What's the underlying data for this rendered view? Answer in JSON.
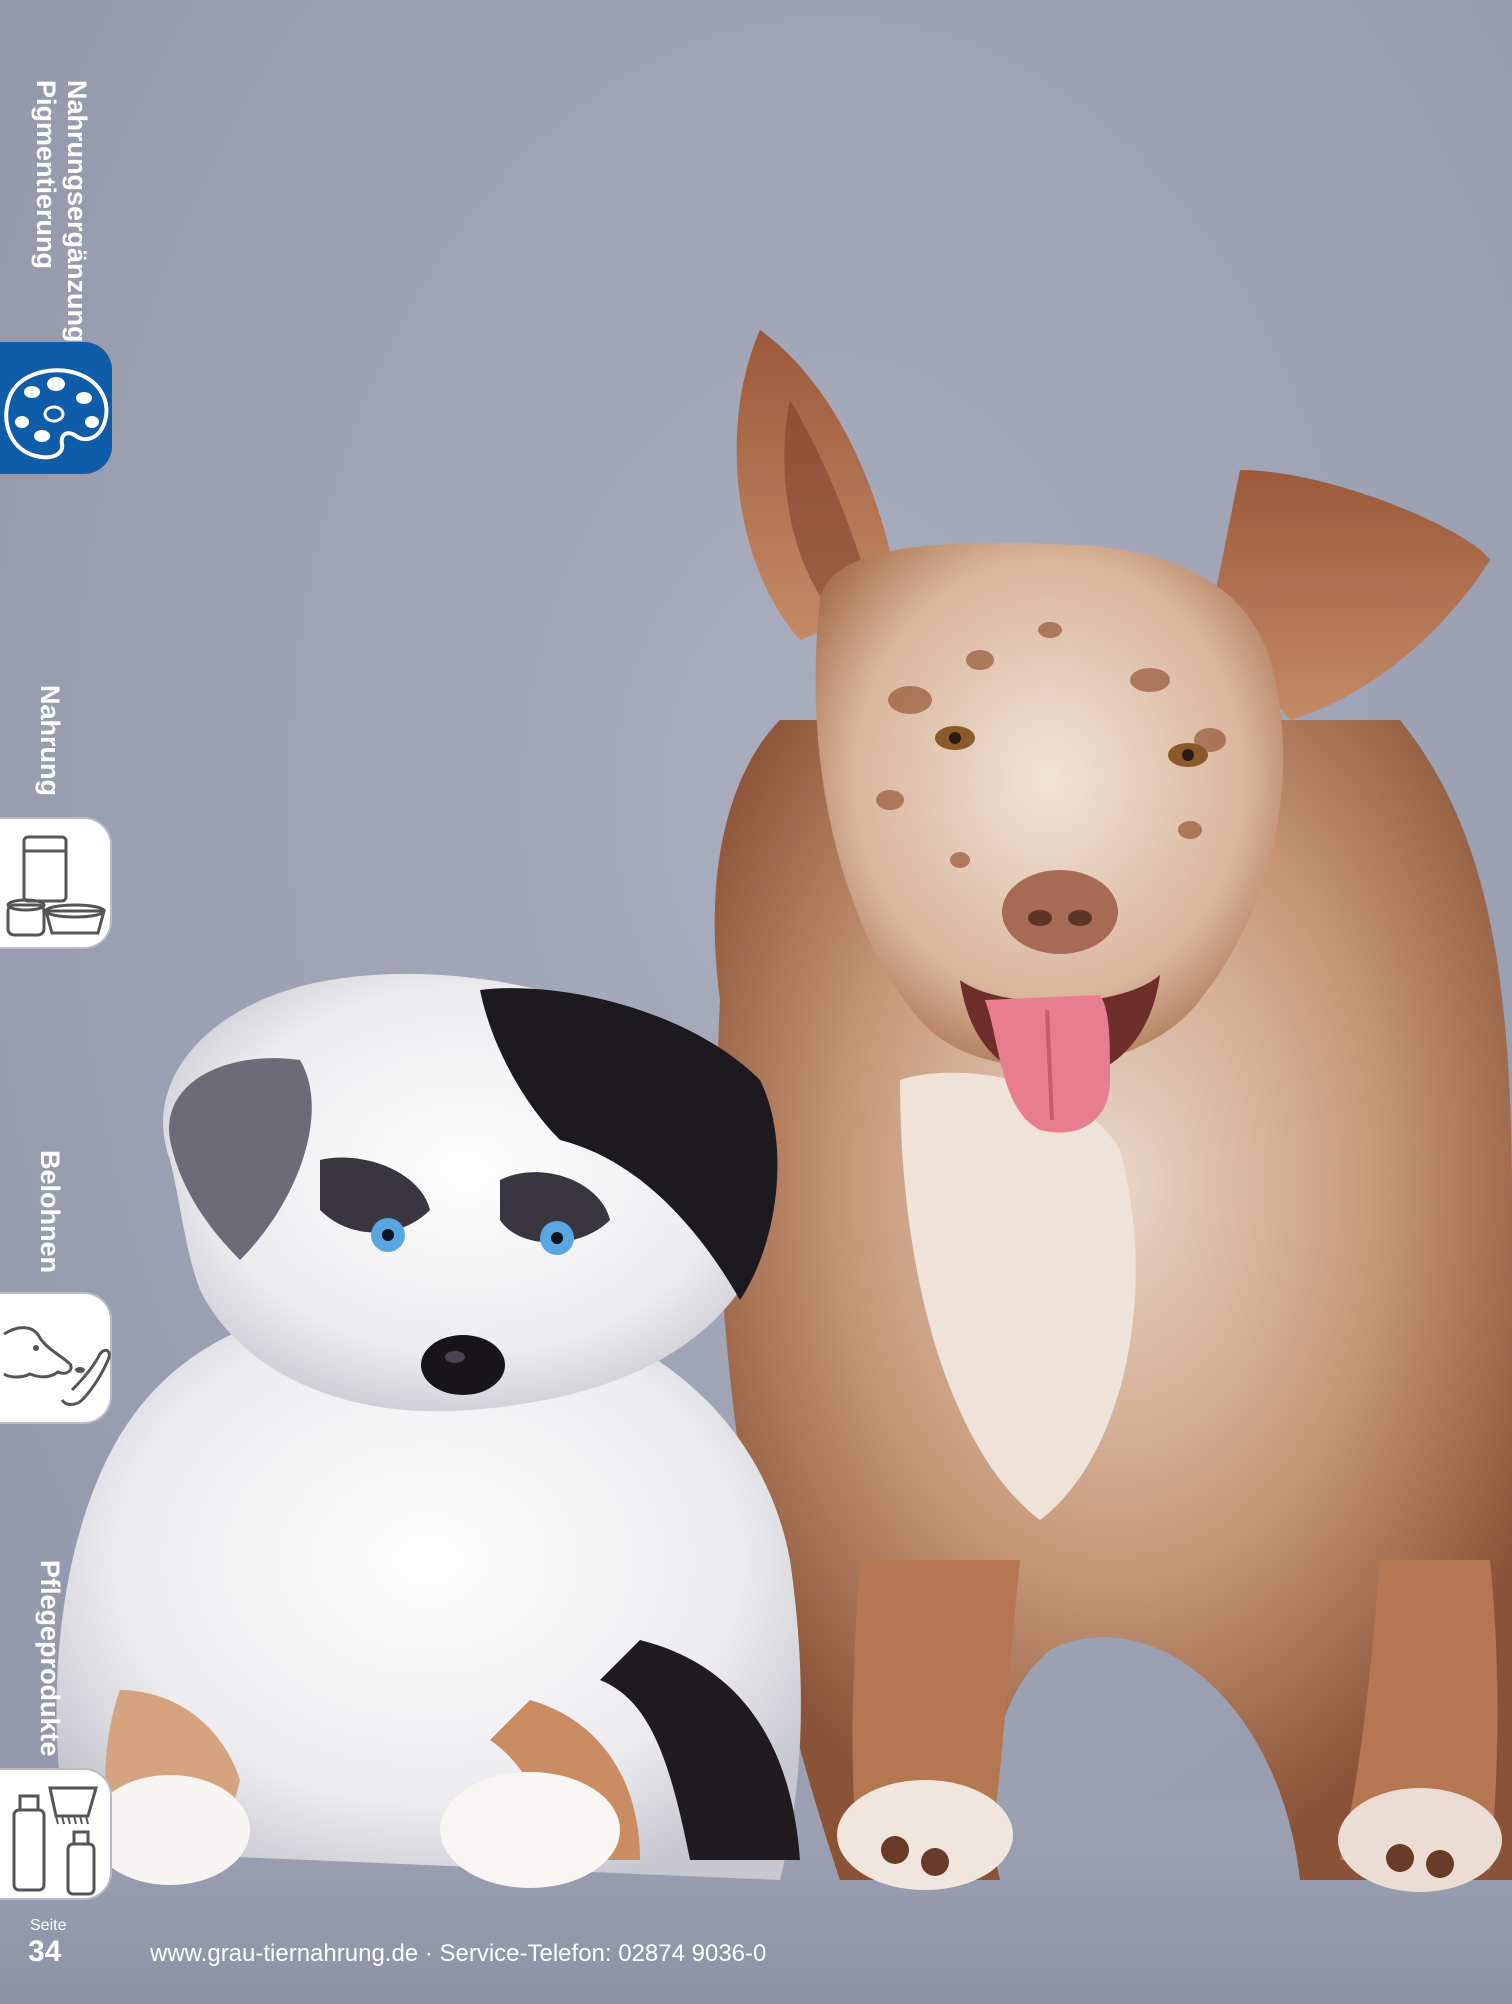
{
  "sidebar": {
    "tabs": [
      {
        "label_lines": [
          "Nahrungsergänzung",
          "Pigmentierung"
        ],
        "icon": "palette-icon",
        "active": true
      },
      {
        "label_lines": [
          "Nahrung"
        ],
        "icon": "food-bag-bowl-icon",
        "active": false
      },
      {
        "label_lines": [
          "Belohnen"
        ],
        "icon": "dog-treat-hand-icon",
        "active": false
      },
      {
        "label_lines": [
          "Pflegeprodukte"
        ],
        "icon": "grooming-products-icon",
        "active": false
      }
    ]
  },
  "footer": {
    "page_word": "Seite",
    "page_number": "34",
    "contact": "www.grau-tiernahrung.de · Service-Telefon: 02874 9036-0"
  },
  "colors": {
    "active_tab": "#0f5ca8",
    "background": "#9ea3b5",
    "text": "#ffffff"
  },
  "photo": {
    "subject": "two-dogs-photo"
  }
}
